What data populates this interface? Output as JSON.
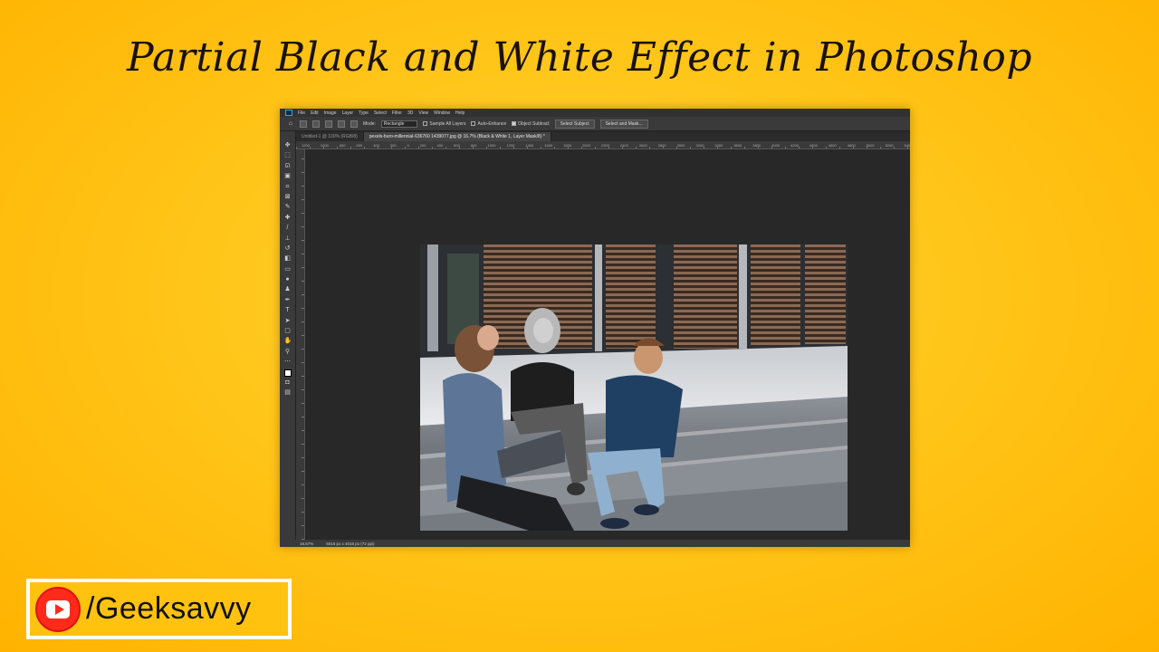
{
  "title": "Partial Black and White Effect in Photoshop",
  "photoshop": {
    "menu": [
      "File",
      "Edit",
      "Image",
      "Layer",
      "Type",
      "Select",
      "Filter",
      "3D",
      "View",
      "Window",
      "Help"
    ],
    "options": {
      "mode_label": "Mode:",
      "mode_value": "Rectangle",
      "sample_all_layers": "Sample All Layers",
      "auto_enhance": "Auto-Enhance",
      "object_subtract": "Object Subtract",
      "select_subject": "Select Subject",
      "select_and_mask": "Select and Mask..."
    },
    "tabs": [
      {
        "label": "Untitled-1 @ 100% (RGB/8)",
        "active": false
      },
      {
        "label": "pexels-buro-millennial-636760 1439077.jpg @ 16.7% (Black & White 1, Layer Mask/8) *",
        "active": true
      }
    ],
    "ruler_ticks": [
      "1200",
      "1000",
      "800",
      "600",
      "400",
      "200",
      "0",
      "200",
      "400",
      "600",
      "800",
      "1000",
      "1200",
      "1400",
      "1600",
      "1800",
      "2000",
      "2200",
      "2400",
      "2600",
      "2800",
      "3000",
      "3200",
      "3400",
      "3600",
      "3800",
      "4000",
      "4200",
      "4400",
      "4600",
      "4800",
      "5000",
      "5200",
      "5400",
      "5600",
      "5800",
      "6000",
      "6200",
      "6400",
      "6600",
      "6800",
      "7000"
    ],
    "status": {
      "zoom": "16.67%",
      "doc_size": "6016 px x 4016 px (72 ppi)"
    }
  },
  "branding": {
    "handle": "/Geeksavvy",
    "icon": "youtube-icon",
    "accent": "#ff2a1a"
  },
  "colors": {
    "background": "#ffc61a",
    "ps_dark": "#282828"
  }
}
